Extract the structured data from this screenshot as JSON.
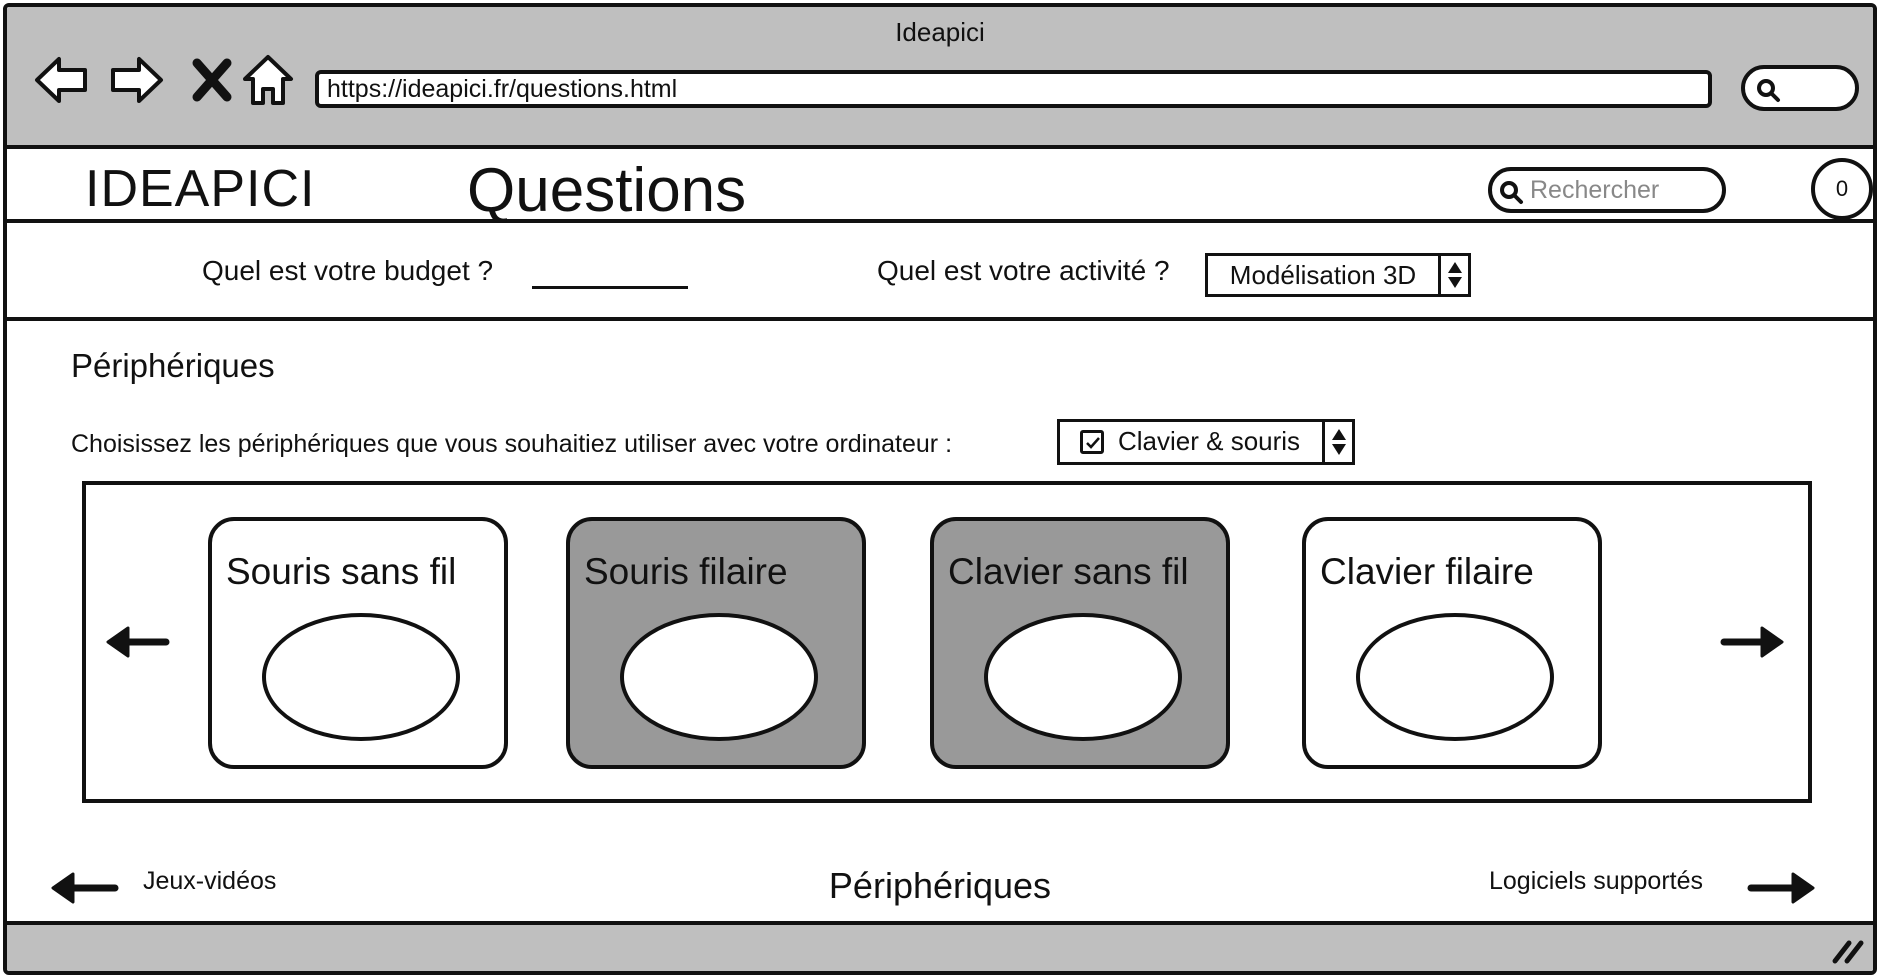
{
  "window": {
    "title": "Ideapici"
  },
  "browser": {
    "url": "https://ideapici.fr/questions.html",
    "icons": [
      "back-icon",
      "forward-icon",
      "close-icon",
      "home-icon",
      "search-icon"
    ]
  },
  "header": {
    "logo": "IDEAPICI",
    "title": "Questions",
    "search_placeholder": "Rechercher",
    "cart_count": "0"
  },
  "questions": {
    "budget_label": "Quel est votre budget ?",
    "budget_value": "",
    "activity_label": "Quel est votre activité ?",
    "activity_value": "Modélisation 3D"
  },
  "peripherals": {
    "title": "Périphériques",
    "choose_label": "Choisissez les périphériques que vous souhaitiez utiliser avec votre ordinateur :",
    "choice_value": "Clavier & souris",
    "choice_checked": true,
    "cards": [
      {
        "label": "Souris sans fil",
        "selected": false
      },
      {
        "label": "Souris filaire",
        "selected": true
      },
      {
        "label": "Clavier sans fil",
        "selected": true
      },
      {
        "label": "Clavier filaire",
        "selected": false
      }
    ]
  },
  "footer_nav": {
    "prev": "Jeux-vidéos",
    "current": "Périphériques",
    "next": "Logiciels supportés"
  },
  "colors": {
    "chrome": "#bfbfbf",
    "selected_card": "#999999",
    "ink": "#111111",
    "placeholder": "#888888"
  }
}
